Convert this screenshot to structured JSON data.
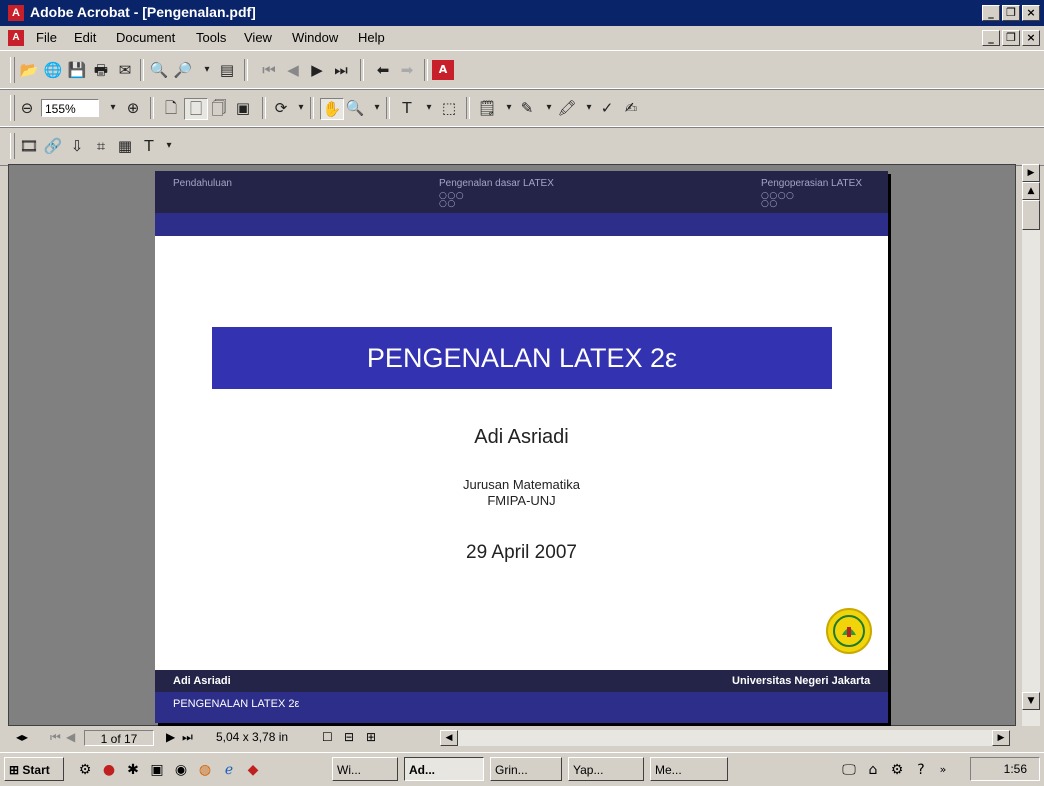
{
  "window": {
    "title": "Adobe Acrobat - [Pengenalan.pdf]"
  },
  "menu": [
    "File",
    "Edit",
    "Document",
    "Tools",
    "View",
    "Window",
    "Help"
  ],
  "toolbar": {
    "zoom_value": "155%"
  },
  "slide": {
    "nav": [
      {
        "label": "Pendahuluan"
      },
      {
        "label": "Pengenalan dasar LATEX",
        "dots1": "○○○",
        "dots2": "○○"
      },
      {
        "label": "Pengoperasian LATEX",
        "dots1": "○○○○",
        "dots2": "○○"
      }
    ],
    "title": "PENGENALAN LATEX 2ε",
    "author": "Adi Asriadi",
    "department": "Jurusan Matematika",
    "faculty": "FMIPA-UNJ",
    "date": "29 April 2007",
    "footer_author": "Adi Asriadi",
    "footer_institution": "Universitas Negeri Jakarta",
    "footer_title": "PENGENALAN LATEX 2ε"
  },
  "status": {
    "page_indicator": "1 of 17",
    "page_size": "5,04 x 3,78 in"
  },
  "taskbar": {
    "start": "Start",
    "tasks": [
      "Wi...",
      "Ad...",
      "Grin...",
      "Yap...",
      "Me..."
    ],
    "clock": "1:56"
  }
}
